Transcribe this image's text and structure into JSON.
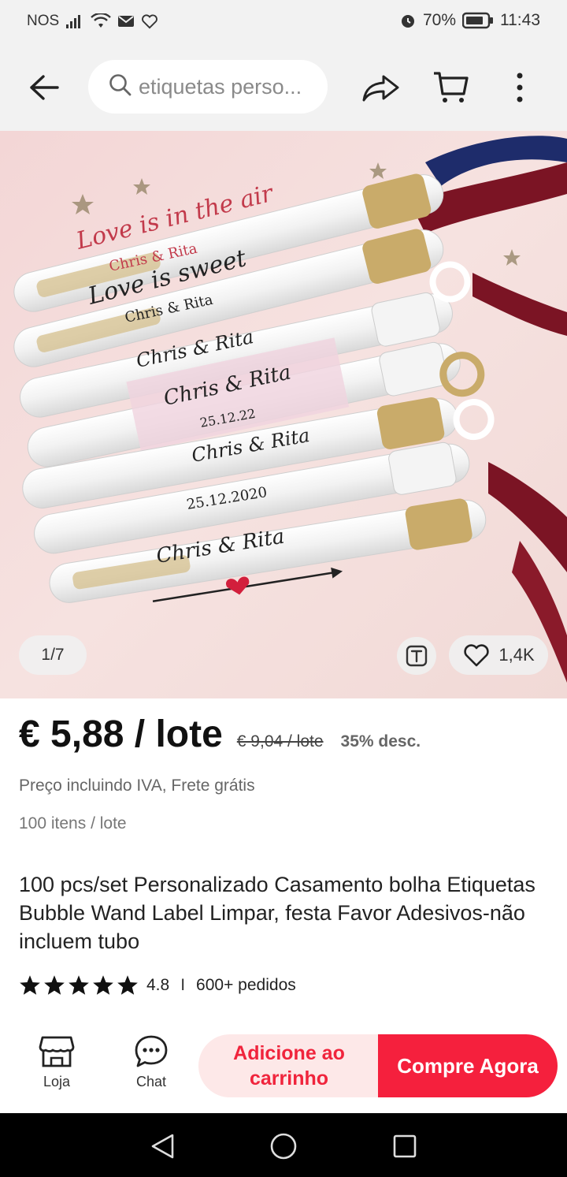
{
  "status_bar": {
    "carrier": "NOS",
    "battery": "70%",
    "time": "11:43"
  },
  "header": {
    "search_placeholder": "etiquetas perso...",
    "icons": [
      "back-arrow-icon",
      "search-icon",
      "share-icon",
      "cart-icon",
      "more-vertical-icon"
    ]
  },
  "gallery": {
    "counter": "1/7",
    "likes": "1,4K",
    "image_texts": [
      "Love is in the air",
      "Chris & Rita",
      "Love is sweet",
      "Chris & Rita",
      "Chris & Rita",
      "Chris & Rita",
      "25.12.22",
      "Chris & Rita",
      "25.12.2020",
      "Chris & Rita"
    ]
  },
  "price": {
    "current": "€ 5,88 / lote",
    "original": "€ 9,04 / lote",
    "discount": "35% desc.",
    "tax_note": "Preço incluindo IVA, Frete grátis",
    "lot_size": "100 itens / lote"
  },
  "product": {
    "title": "100 pcs/set Personalizado Casamento bolha Etiquetas Bubble Wand Label Limpar, festa Favor Adesivos-não incluem tubo",
    "rating": "4.8",
    "stars": 5,
    "separator": "I",
    "orders": "600+ pedidos"
  },
  "action_bar": {
    "shop_label": "Loja",
    "chat_label": "Chat",
    "add_to_cart": "Adicione ao carrinho",
    "buy_now": "Compre Agora"
  },
  "colors": {
    "accent": "#f5203d",
    "accent_light": "#fde8e8",
    "bar_bg": "#f2f2f2"
  }
}
